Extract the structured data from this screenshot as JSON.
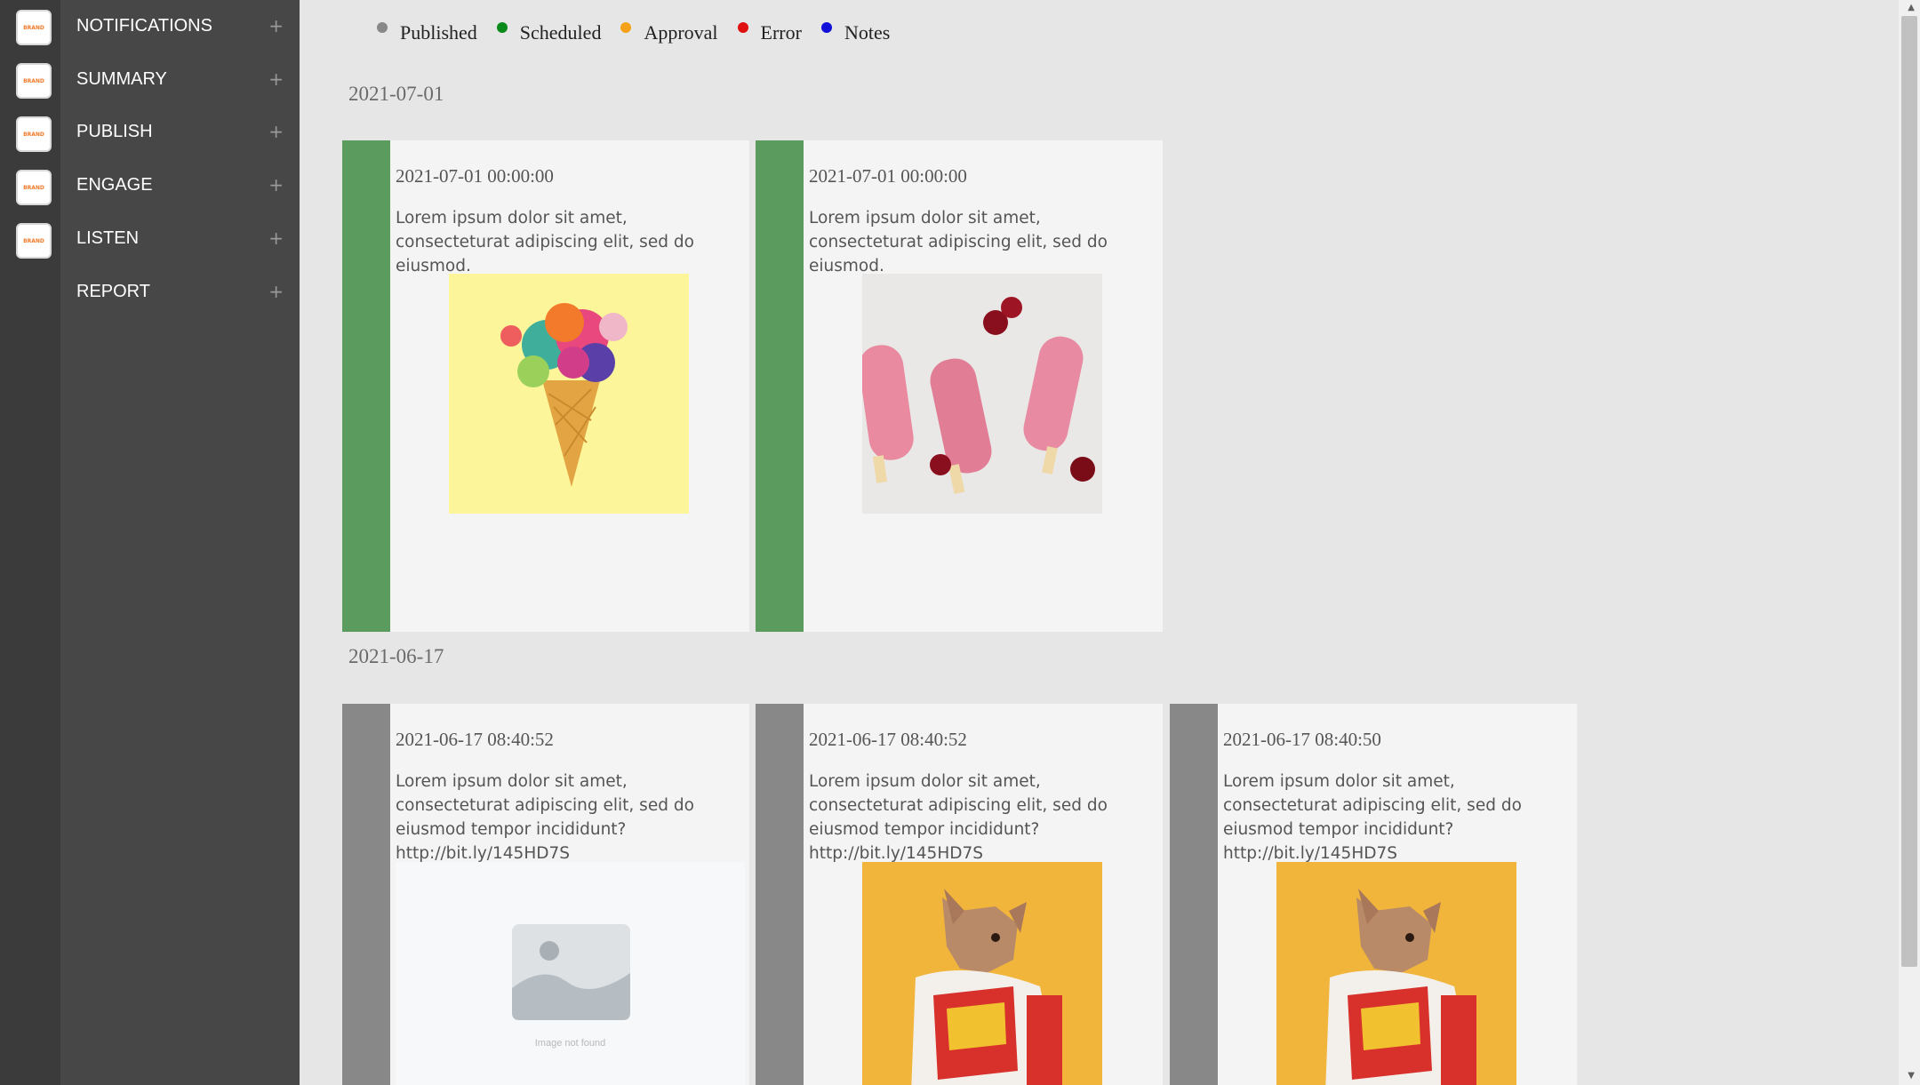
{
  "sidebar": {
    "brand_label": "BRAND",
    "items": [
      {
        "label": "NOTIFICATIONS",
        "expand": "+"
      },
      {
        "label": "SUMMARY",
        "expand": "+"
      },
      {
        "label": "PUBLISH",
        "expand": "+"
      },
      {
        "label": "ENGAGE",
        "expand": "+"
      },
      {
        "label": "LISTEN",
        "expand": "+"
      },
      {
        "label": "REPORT",
        "expand": "+"
      }
    ]
  },
  "legend": [
    {
      "label": "Published",
      "color": "#888888"
    },
    {
      "label": "Scheduled",
      "color": "#0a8a1a"
    },
    {
      "label": "Approval",
      "color": "#f5a21a"
    },
    {
      "label": "Error",
      "color": "#e01010"
    },
    {
      "label": "Notes",
      "color": "#1010d8"
    }
  ],
  "groups": [
    {
      "date": "2021-07-01",
      "status_color": "#5b9b5e",
      "posts": [
        {
          "time": "2021-07-01 00:00:00",
          "text": "Lorem ipsum dolor sit amet, consecteturat adipiscing elit, sed do eiusmod.",
          "image": "confetti ice cream cone on yellow"
        },
        {
          "time": "2021-07-01 00:00:00",
          "text": "Lorem ipsum dolor sit amet, consecteturat adipiscing elit, sed do eiusmod.",
          "image": "cherry popsicles on ice"
        }
      ]
    },
    {
      "date": "2021-06-17",
      "status_color": "#888888",
      "posts": [
        {
          "time": "2021-06-17 08:40:52",
          "text": "Lorem ipsum dolor sit amet, consecteturat adipiscing elit, sed do eiusmod tempor incididunt? http://bit.ly/145HD7S",
          "image_missing_label": "Image not found"
        },
        {
          "time": "2021-06-17 08:40:52",
          "text": "Lorem ipsum dolor sit amet, consecteturat adipiscing elit, sed do eiusmod tempor incididunt? http://bit.ly/145HD7S",
          "image": "french bulldog in fries sweater"
        },
        {
          "time": "2021-06-17 08:40:50",
          "text": "Lorem ipsum dolor sit amet, consecteturat adipiscing elit, sed do eiusmod tempor incididunt? http://bit.ly/145HD7S",
          "image": "french bulldog in fries sweater"
        }
      ]
    }
  ]
}
